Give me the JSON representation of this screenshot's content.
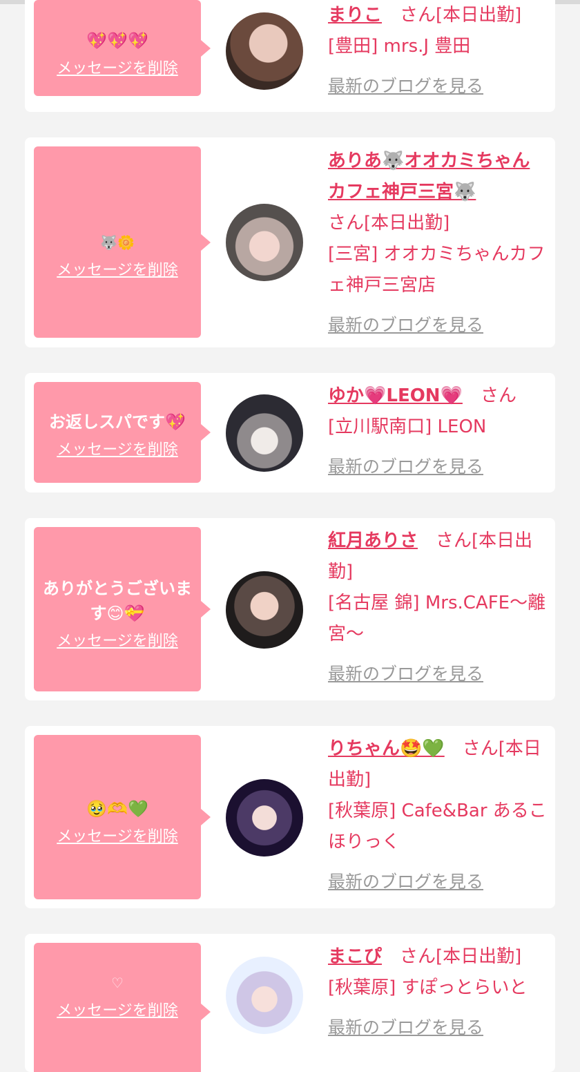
{
  "cards": [
    {
      "message": "💖💖💖",
      "delete_label": "メッセージを削除",
      "name": "まりこ",
      "suffix": "さん[本日出勤]",
      "shop": "[豊田] mrs.J 豊田",
      "blog_label": "最新のブログを見る"
    },
    {
      "message": "🐺🌼",
      "delete_label": "メッセージを削除",
      "name": "ありあ🐺オオカミちゃんカフェ神戸三宮🐺",
      "suffix": "さん[本日出勤]",
      "shop": "[三宮] オオカミちゃんカフェ神戸三宮店",
      "blog_label": "最新のブログを見る"
    },
    {
      "message": "お返しスパです💖",
      "delete_label": "メッセージを削除",
      "name": "ゆか💗LEON💗",
      "suffix": "さん",
      "shop": "[立川駅南口] LEON",
      "blog_label": "最新のブログを見る"
    },
    {
      "message": "ありがとうございます😊💝",
      "delete_label": "メッセージを削除",
      "name": "紅月ありさ",
      "suffix": "さん[本日出勤]",
      "shop": "[名古屋 錦] Mrs.CAFE〜離宮〜",
      "blog_label": "最新のブログを見る"
    },
    {
      "message": "🥹🫶💚",
      "delete_label": "メッセージを削除",
      "name": "りちゃん🤩💚",
      "suffix": "さん[本日出勤]",
      "shop": "[秋葉原] Cafe&Bar あるこほりっく",
      "blog_label": "最新のブログを見る"
    },
    {
      "message": "♡",
      "delete_label": "メッセージを削除",
      "name": "まこぴ",
      "suffix": "さん[本日出勤]",
      "shop": "[秋葉原] すぽっとらいと",
      "blog_label": "最新のブログを見る"
    }
  ],
  "colors": {
    "accent": "#e5395f",
    "bubble": "#ff99aa",
    "link_gray": "#999999",
    "background": "#f3f3f3"
  }
}
